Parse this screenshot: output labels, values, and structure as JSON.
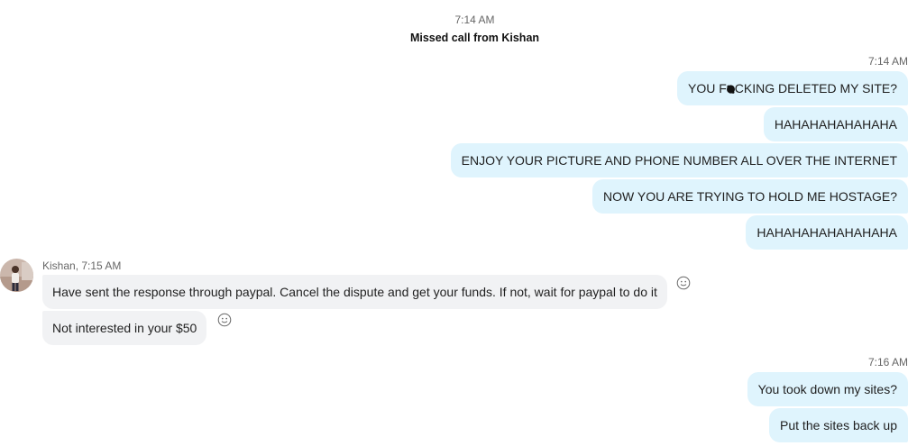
{
  "system": {
    "time": "7:14 AM",
    "text": "Missed call from Kishan"
  },
  "outgoing_group_1": {
    "time": "7:14 AM",
    "messages": [
      {
        "pre": "YOU F",
        "post": "CKING DELETED MY SITE?"
      },
      {
        "text": "HAHAHAHAHAHAHA"
      },
      {
        "text": "ENJOY YOUR PICTURE AND PHONE NUMBER ALL OVER THE INTERNET"
      },
      {
        "text": "NOW YOU ARE TRYING TO HOLD ME HOSTAGE?"
      },
      {
        "text": "HAHAHAHAHAHAHAHA"
      }
    ]
  },
  "incoming_group": {
    "sender_meta": "Kishan, 7:15 AM",
    "messages": [
      {
        "text": "Have sent the response through paypal. Cancel the dispute and get your funds. If not, wait for paypal to do it"
      },
      {
        "text": "Not interested in your $50"
      }
    ]
  },
  "outgoing_group_2": {
    "time": "7:16 AM",
    "messages": [
      {
        "text": "You took down my sites?"
      },
      {
        "text": "Put the sites back up"
      }
    ]
  },
  "icons": {
    "reaction": "smiley-reaction-icon",
    "avatar": "contact-avatar"
  },
  "colors": {
    "outgoing_bubble": "#dff4fd",
    "incoming_bubble": "#f1f2f4"
  }
}
